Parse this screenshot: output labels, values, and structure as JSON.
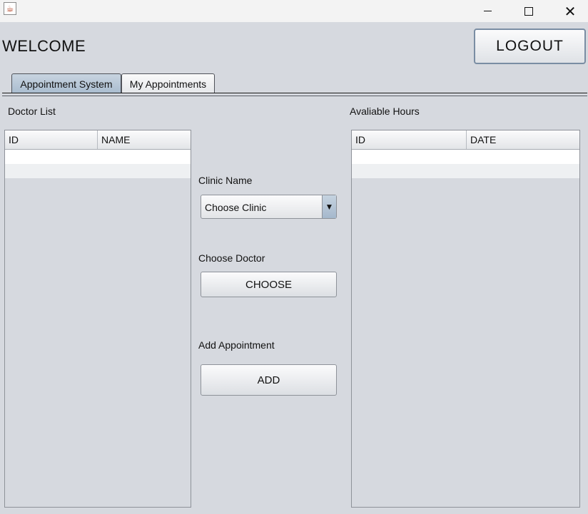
{
  "titlebar": {
    "app_icon": "java-cup-icon",
    "minimize_icon": "minimize-icon",
    "maximize_icon": "maximize-icon",
    "close_icon": "close-icon",
    "close_glyph": "✕"
  },
  "header": {
    "welcome": "WELCOME",
    "logout_label": "LOGOUT"
  },
  "tabs": [
    {
      "label": "Appointment System",
      "active": true
    },
    {
      "label": "My Appointments",
      "active": false
    }
  ],
  "doctor_list": {
    "title": "Doctor List",
    "columns": [
      "ID",
      "NAME"
    ],
    "rows": []
  },
  "available_hours": {
    "title": "Avaliable Hours",
    "columns": [
      "ID",
      "DATE"
    ],
    "rows": []
  },
  "form": {
    "clinic_label": "Clinic Name",
    "clinic_selected": "Choose Clinic",
    "clinic_arrow": "▼",
    "doctor_label": "Choose Doctor",
    "choose_button": "CHOOSE",
    "add_label": "Add Appointment",
    "add_button": "ADD"
  },
  "colors": {
    "background": "#d6d9df",
    "tab_active": "#a9bccf",
    "logout_border": "#7a8da3"
  }
}
